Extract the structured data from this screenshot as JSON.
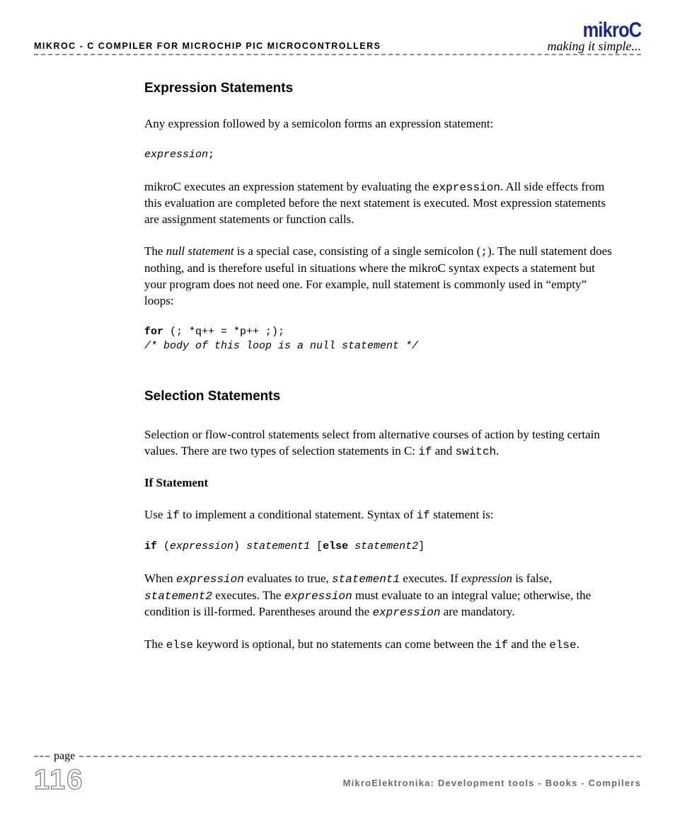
{
  "header": {
    "left": "mikroC - C Compiler for Microchip PIC microcontrollers",
    "brand": "mikroC",
    "tagline": "making it simple..."
  },
  "section1": {
    "heading": "Expression Statements",
    "p1": "Any expression followed by a semicolon forms an expression statement:",
    "code1_expr": "expression",
    "code1_semi": ";",
    "p2_a": "mikroC executes an expression statement by evaluating the ",
    "p2_code": "expression",
    "p2_b": ". All side effects from this evaluation are completed before the next statement is executed. Most expression statements are assignment statements or function calls.",
    "p3_a": "The ",
    "p3_ital": "null statement",
    "p3_b": " is a special case, consisting of a single semicolon (",
    "p3_code": ";",
    "p3_c": "). The null statement does nothing, and is therefore useful in situations where the mikroC syntax expects a statement but your program does not need one. For example, null statement is commonly used in “empty” loops:",
    "code2_kw": "for",
    "code2_rest": " (; *q++ = *p++ ;);",
    "code2_comment": "/* body of this loop is a null statement */"
  },
  "section2": {
    "heading": "Selection Statements",
    "p1_a": "Selection or flow-control statements select from alternative courses of action by testing certain values. There are two types of selection statements in C: ",
    "p1_code1": "if",
    "p1_b": " and ",
    "p1_code2": "switch",
    "p1_c": ".",
    "sub1": "If Statement",
    "p2_a": "Use ",
    "p2_code1": "if",
    "p2_b": " to implement a conditional statement. Syntax of ",
    "p2_code2": "if",
    "p2_c": " statement is:",
    "code3_if": "if",
    "code3_open": " (",
    "code3_expr": "expression",
    "code3_close": ") ",
    "code3_s1": "statement1",
    "code3_sp": " [",
    "code3_else": "else",
    "code3_sp2": " ",
    "code3_s2": "statement2",
    "code3_end": "]",
    "p3_a": "When ",
    "p3_code1": "expression",
    "p3_b": " evaluates to true, ",
    "p3_code2": "statement1",
    "p3_c": " executes. If ",
    "p3_ital": "expression",
    "p3_d": " is false, ",
    "p3_code3": "statement2",
    "p3_e": " executes. The ",
    "p3_code4": "expression",
    "p3_f": " must evaluate to an integral value; otherwise, the condition is ill-formed. Parentheses around the ",
    "p3_code5": "expression",
    "p3_g": " are mandatory.",
    "p4_a": "The ",
    "p4_code1": "else",
    "p4_b": " keyword is optional, but no statements can come between the ",
    "p4_code2": "if",
    "p4_c": " and the ",
    "p4_code3": "else",
    "p4_d": "."
  },
  "footer": {
    "page_word": "page",
    "page_num": "116",
    "text": "MikroElektronika: Development tools - Books - Compilers"
  }
}
